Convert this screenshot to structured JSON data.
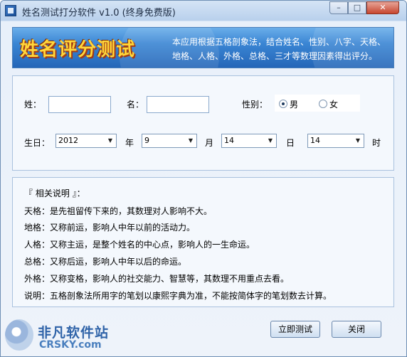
{
  "window": {
    "title": "姓名测试打分软件 v1.0 (终身免费版)",
    "controls": {
      "minimize": "–",
      "maximize": "□",
      "close": "✕"
    }
  },
  "banner": {
    "title": "姓名评分测试",
    "description": "本应用根据五格剖象法，结合姓名、性别、八字、天格、地格、人格、外格、总格、三才等数理因素得出评分。"
  },
  "form": {
    "surname_label": "姓：",
    "surname_value": "",
    "given_name_label": "名：",
    "given_name_value": "",
    "gender_label": "性别：",
    "gender_options": [
      {
        "label": "男",
        "selected": true
      },
      {
        "label": "女",
        "selected": false
      }
    ],
    "birth_label": "生日：",
    "year": {
      "value": "2012",
      "unit": "年"
    },
    "month": {
      "value": "9",
      "unit": "月"
    },
    "day": {
      "value": "14",
      "unit": "日"
    },
    "hour": {
      "value": "14",
      "unit": "时"
    }
  },
  "description": {
    "heading": "『 相关说明 』：",
    "lines": [
      "天格：是先祖留传下来的，其数理对人影响不大。",
      "地格：又称前运，影响人中年以前的活动力。",
      "人格：又称主运，是整个姓名的中心点，影响人的一生命运。",
      "总格：又称后运，影响人中年以后的命运。",
      "外格：又称变格，影响人的社交能力、智慧等，其数理不用重点去看。",
      "说明：五格剖象法所用字的笔划以康熙字典为准，不能按简体字的笔划数去计算。"
    ]
  },
  "buttons": {
    "test": "立即测试",
    "close": "关闭"
  },
  "watermark": {
    "cn": "非凡软件站",
    "en": "CRSKY.com"
  }
}
